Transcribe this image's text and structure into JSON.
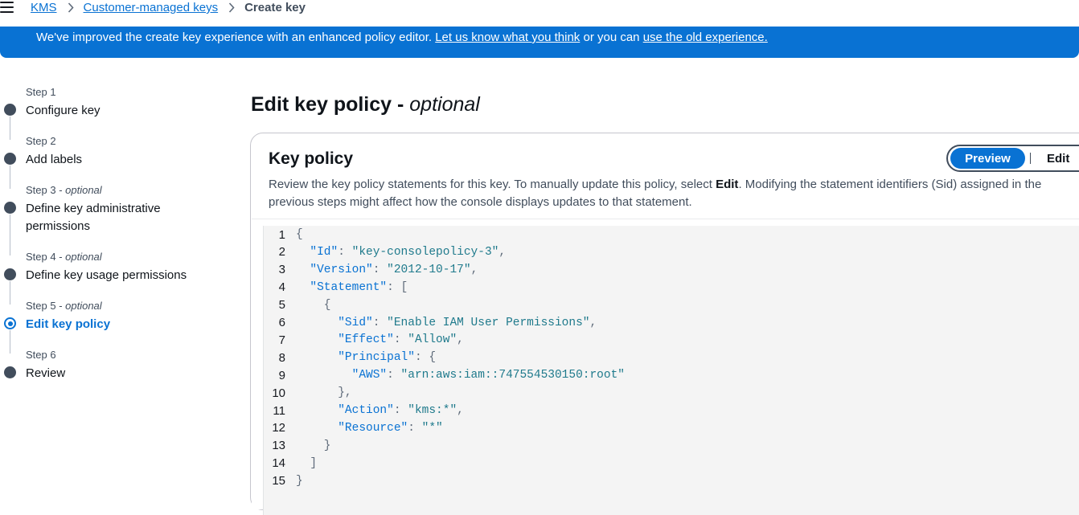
{
  "breadcrumb": {
    "items": [
      "KMS",
      "Customer-managed keys"
    ],
    "current": "Create key"
  },
  "banner": {
    "text_before": "We've improved the create key experience with an enhanced policy editor. ",
    "feedback_link": "Let us know what you think",
    "text_middle": " or you can ",
    "old_link": "use the old experience."
  },
  "steps": [
    {
      "num": "Step 1",
      "optional": "",
      "title": "Configure key",
      "state": "done"
    },
    {
      "num": "Step 2",
      "optional": "",
      "title": "Add labels",
      "state": "done"
    },
    {
      "num": "Step 3 - ",
      "optional": "optional",
      "title": "Define key administrative permissions",
      "state": "done"
    },
    {
      "num": "Step 4 - ",
      "optional": "optional",
      "title": "Define key usage permissions",
      "state": "done"
    },
    {
      "num": "Step 5 - ",
      "optional": "optional",
      "title": "Edit key policy",
      "state": "active"
    },
    {
      "num": "Step 6",
      "optional": "",
      "title": "Review",
      "state": "pending"
    }
  ],
  "page": {
    "title": "Edit key policy - ",
    "title_suffix": "optional"
  },
  "card": {
    "title": "Key policy",
    "desc_before": "Review the key policy statements for this key. To manually update this policy, select ",
    "desc_bold": "Edit",
    "desc_after": ". Modifying the statement identifiers (Sid) assigned in the previous steps might affect how the console displays updates to that statement.",
    "preview_label": "Preview",
    "edit_label": "Edit"
  },
  "code_lines": [
    "{",
    "  \"Id\": \"key-consolepolicy-3\",",
    "  \"Version\": \"2012-10-17\",",
    "  \"Statement\": [",
    "    {",
    "      \"Sid\": \"Enable IAM User Permissions\",",
    "      \"Effect\": \"Allow\",",
    "      \"Principal\": {",
    "        \"AWS\": \"arn:aws:iam::747554530150:root\"",
    "      },",
    "      \"Action\": \"kms:*\",",
    "      \"Resource\": \"*\"",
    "    }",
    "  ]",
    "}"
  ],
  "colors": {
    "accent": "#0972d3",
    "text": "#0f141a",
    "muted": "#414d5c"
  }
}
